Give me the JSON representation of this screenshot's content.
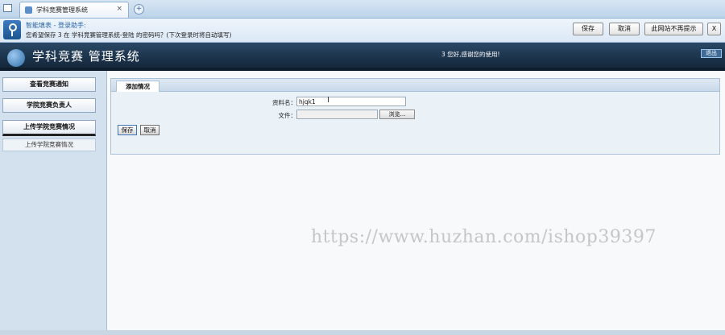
{
  "browser": {
    "tab_title": "学科竞赛管理系统",
    "tab_close": "×",
    "new_tab": "+"
  },
  "password_helper": {
    "title": "智能填表 - 登录助手:",
    "message": "您希望保存 3 在 学科竞赛管理系统-登陆 的密码吗？(下次登录时将自动填写)",
    "save_label": "保存",
    "cancel_label": "取消",
    "never_label": "此网站不再提示",
    "close_label": "X"
  },
  "header": {
    "app_title": "学科竞赛 管理系统",
    "welcome": "3 您好,感谢您的使用!",
    "logout_label": "退出"
  },
  "sidebar": {
    "items": [
      {
        "label": "查看竞赛通知"
      },
      {
        "label": "学院竞赛负责人"
      },
      {
        "label": "上传学院竞赛情况"
      }
    ],
    "sub_items": [
      {
        "label": "上传学院竞赛情况"
      }
    ]
  },
  "form": {
    "tab_label": "添加情况",
    "name_label": "资料名：",
    "name_value": "hjqk1",
    "file_label": "文件：",
    "file_value": "",
    "browse_label": "浏览...",
    "save_label": "保存",
    "cancel_label": "取消"
  },
  "watermark": "https://www.huzhan.com/ishop39397"
}
